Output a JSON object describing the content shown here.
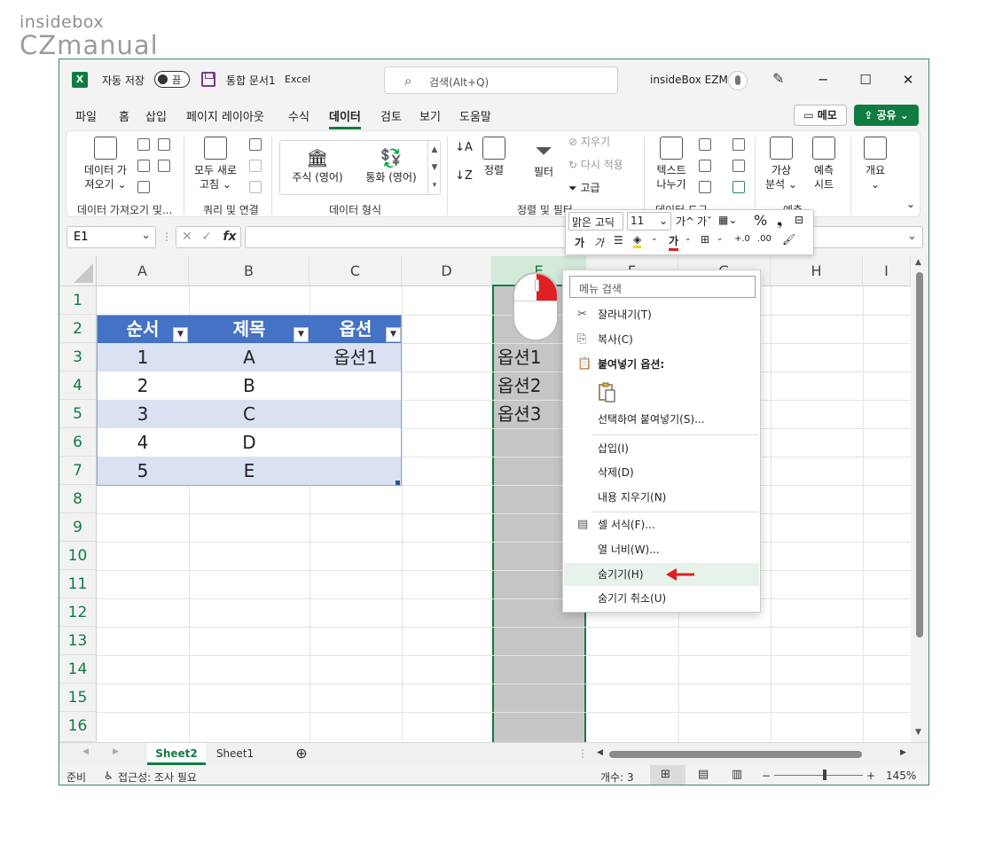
{
  "watermark": {
    "top": "insidebox",
    "big": "CZmanual"
  },
  "titlebar": {
    "app_icon": "excel-icon",
    "autosave_label": "자동 저장",
    "autosave_state": "끔",
    "doc_title": "통합 문서1",
    "app_name": "Excel",
    "search_placeholder": "검색(Alt+Q)",
    "user_name": "insideBox EZM",
    "minimize": "─",
    "maximize": "☐",
    "close": "✕"
  },
  "menu": {
    "items": [
      "파일",
      "홈",
      "삽입",
      "페이지 레이아웃",
      "수식",
      "데이터",
      "검토",
      "보기",
      "도움말"
    ],
    "active": "데이터",
    "memo": "메모",
    "share": "공유"
  },
  "ribbon": {
    "get_data": "데이터 가",
    "get_data2": "져오기",
    "refresh_all": "모두 새로",
    "refresh_all2": "고침",
    "stocks": "주식 (영어)",
    "currencies": "통화 (영어)",
    "sort": "정렬",
    "filter": "필터",
    "clear": "지우기",
    "reapply": "다시 적용",
    "advanced": "고급",
    "text_to_columns": "텍스트",
    "text_to_columns2": "나누기",
    "what_if": "가상",
    "what_if2": "분석",
    "forecast": "예측",
    "forecast2": "시트",
    "outline": "개요",
    "groups": {
      "get_transform": "데이터 가져오기 및...",
      "queries": "쿼리 및 연결",
      "data_types": "데이터 형식",
      "sort_filter": "정렬 및 필터",
      "data_tools": "데이터 도구",
      "forecast": "예측"
    }
  },
  "formula_bar": {
    "name_box": "E1",
    "fx": "fx"
  },
  "columns": [
    "A",
    "B",
    "C",
    "D",
    "E",
    "F",
    "G",
    "H",
    "I"
  ],
  "rows": [
    "1",
    "2",
    "3",
    "4",
    "5",
    "6",
    "7",
    "8",
    "9",
    "10",
    "11",
    "12",
    "13",
    "14",
    "15",
    "16"
  ],
  "table": {
    "headers": [
      "순서",
      "제목",
      "옵션"
    ],
    "rows": [
      [
        "1",
        "A",
        "옵션1"
      ],
      [
        "2",
        "B",
        ""
      ],
      [
        "3",
        "C",
        ""
      ],
      [
        "4",
        "D",
        ""
      ],
      [
        "5",
        "E",
        ""
      ]
    ]
  },
  "column_e_values": [
    "옵션1",
    "옵션2",
    "옵션3"
  ],
  "mini_toolbar": {
    "font": "맑은 고딕",
    "size": "11",
    "grow": "가^",
    "shrink": "가ˇ",
    "percent": "%",
    "comma": "❟",
    "bold": "가",
    "italic": "가",
    "font_color_letter": "가"
  },
  "context_menu": {
    "search_placeholder": "메뉴 검색",
    "items": {
      "cut": "잘라내기(T)",
      "copy": "복사(C)",
      "paste_options": "붙여넣기 옵션:",
      "paste_special": "선택하여 붙여넣기(S)...",
      "insert": "삽입(I)",
      "delete": "삭제(D)",
      "clear_contents": "내용 지우기(N)",
      "format_cells": "셀 서식(F)...",
      "column_width": "열 너비(W)...",
      "hide": "숨기기(H)",
      "unhide": "숨기기 취소(U)"
    }
  },
  "sheets": {
    "tabs": [
      "Sheet2",
      "Sheet1"
    ],
    "active": "Sheet2",
    "add": "⊕"
  },
  "status": {
    "ready": "준비",
    "accessibility": "접근성: 조사 필요",
    "count": "개수: 3",
    "zoom": "145%",
    "minus": "−",
    "plus": "+"
  },
  "colors": {
    "accent": "#107c41",
    "table_header": "#4472c4",
    "table_band": "#d9e1f2",
    "arrow": "#e02020"
  }
}
